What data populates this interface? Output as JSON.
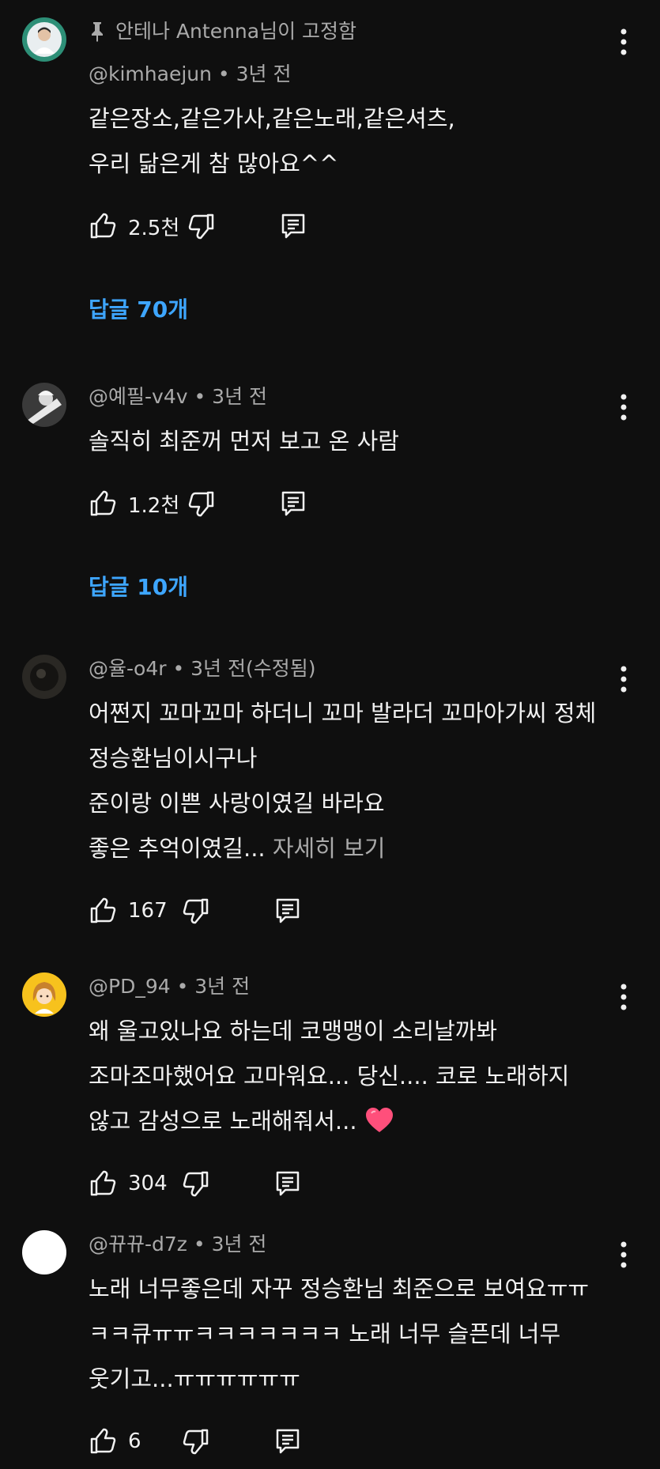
{
  "comments": [
    {
      "pinned_text": "안테나 Antenna님이 고정함",
      "author": "@kimhaejun",
      "time": "3년 전",
      "lines": [
        "같은장소,같은가사,같은노래,같은셔츠,",
        "우리 닮은게 참 많아요^^"
      ],
      "likes": "2.5천",
      "replies": "답글 70개"
    },
    {
      "author": "@예필-v4v",
      "time": "3년 전",
      "lines": [
        "솔직히 최준꺼 먼저 보고 온 사람"
      ],
      "likes": "1.2천",
      "replies": "답글 10개"
    },
    {
      "author": "@율-o4r",
      "time": "3년 전(수정됨)",
      "lines": [
        "어쩐지 꼬마꼬마 하더니 꼬마 발라더 꼬마아가씨 정체",
        "정승환님이시구나",
        "준이랑 이쁜 사랑이였길 바라요",
        "좋은 추억이였길..."
      ],
      "more_label": "자세히 보기",
      "likes": "167"
    },
    {
      "author": "@PD_94",
      "time": "3년 전",
      "lines": [
        "왜 울고있나요 하는데 코맹맹이 소리날까봐",
        "조마조마했어요 고마워요... 당신.... 코로 노래하지",
        "않고 감성으로 노래해줘서..."
      ],
      "likes": "304"
    },
    {
      "author": "@뀨뀨-d7z",
      "time": "3년 전",
      "lines": [
        "노래 너무좋은데 자꾸 정승환님 최준으로 보여요ㅠㅠ",
        "ㅋㅋ큐ㅠㅠㅋㅋㅋㅋㅋㅋㅋ 노래 너무 슬픈데 너무",
        "웃기고...ㅠㅠㅠㅠㅠㅠ"
      ],
      "likes": "6"
    }
  ],
  "separator": " • ",
  "colors": {
    "background": "#0f0f0f",
    "text": "#f1f1f1",
    "secondary": "#aaaaaa",
    "link": "#3ea6ff",
    "heart": "#ff4f7b"
  }
}
